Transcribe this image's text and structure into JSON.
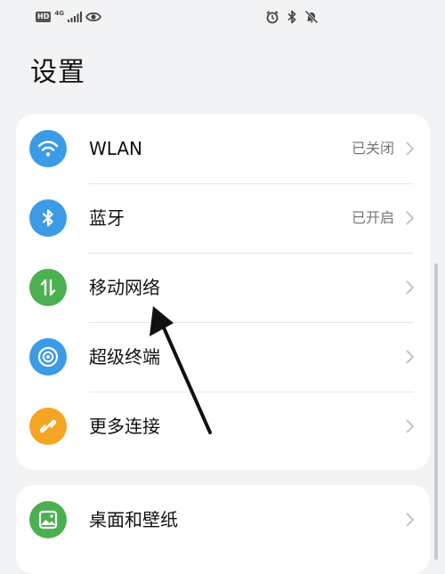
{
  "status_bar": {
    "hd_label": "HD",
    "network_label": "4G",
    "left_icons": [
      "hd-badge",
      "signal-icon",
      "eye-icon"
    ],
    "right_icons": [
      "alarm-icon",
      "bluetooth-icon",
      "mute-icon"
    ]
  },
  "page": {
    "title": "设置"
  },
  "groups": [
    {
      "items": [
        {
          "label": "WLAN",
          "status": "已关闭",
          "icon": "wifi-icon",
          "icon_color": "#3b9be6"
        },
        {
          "label": "蓝牙",
          "status": "已开启",
          "icon": "bluetooth-icon",
          "icon_color": "#3b9be6"
        },
        {
          "label": "移动网络",
          "status": "",
          "icon": "mobile-data-icon",
          "icon_color": "#4caf50"
        },
        {
          "label": "超级终端",
          "status": "",
          "icon": "super-device-icon",
          "icon_color": "#3b9be6"
        },
        {
          "label": "更多连接",
          "status": "",
          "icon": "link-icon",
          "icon_color": "#f5a524"
        }
      ]
    },
    {
      "items": [
        {
          "label": "桌面和壁纸",
          "status": "",
          "icon": "wallpaper-icon",
          "icon_color": "#4caf50"
        }
      ]
    }
  ],
  "colors": {
    "background": "#f1f3f5",
    "card": "#ffffff",
    "annotation_arrow": "#111111"
  }
}
